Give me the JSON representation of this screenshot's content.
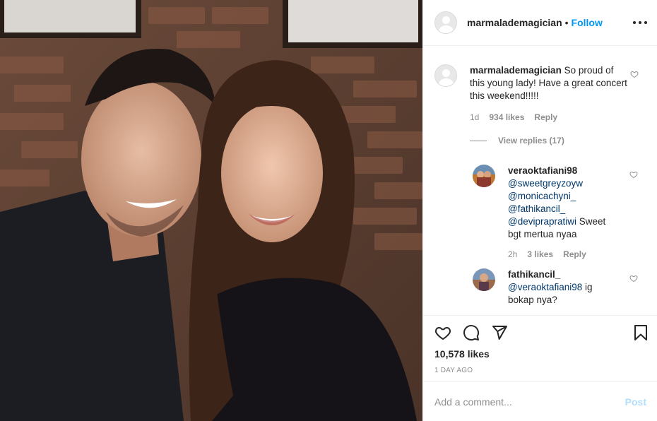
{
  "post": {
    "author": "marmalademagician",
    "follow_label": "Follow",
    "separator": "•"
  },
  "caption": {
    "username": "marmalademagician",
    "text": "So proud of this young lady! Have a great concert this weekend!!!!!",
    "age": "1d",
    "likes": "934 likes",
    "reply_label": "Reply"
  },
  "view_replies": "View replies (17)",
  "replies": [
    {
      "username": "veraoktafiani98",
      "mentions": [
        "@sweetgreyzoyw",
        "@monicachyni_",
        "@fathikancil_",
        "@deviprapratiwi"
      ],
      "text": " Sweet bgt mertua nyaa",
      "age": "2h",
      "likes": "3 likes",
      "reply_label": "Reply"
    },
    {
      "username": "fathikancil_",
      "mentions": [
        "@veraoktafiani98"
      ],
      "text": " ig bokap nya?"
    }
  ],
  "actions": {
    "likes": "10,578 likes",
    "time": "1 DAY AGO"
  },
  "add_comment": {
    "placeholder": "Add a comment...",
    "post_label": "Post"
  },
  "icons": [
    "more-icon",
    "heart-icon",
    "comment-icon",
    "share-icon",
    "bookmark-icon"
  ],
  "colors": {
    "link": "#0095f6",
    "muted": "#8e8e8e",
    "mention": "#00376b",
    "post_disabled": "#b2dffc"
  }
}
